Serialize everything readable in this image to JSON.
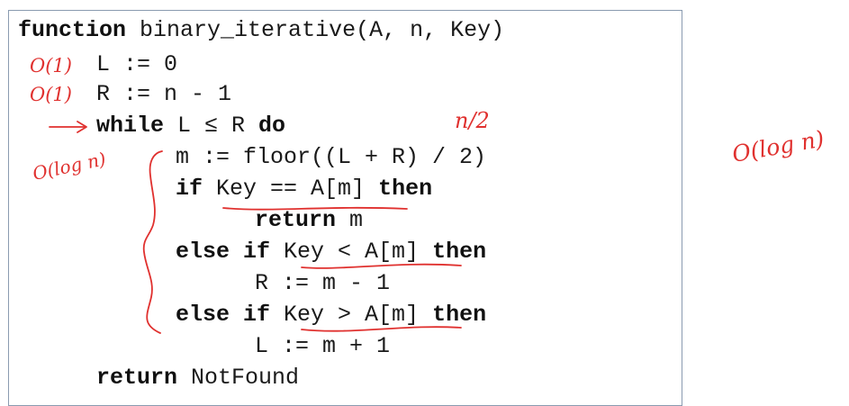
{
  "code": {
    "lines": [
      {
        "kw": "function",
        "text": " binary_iterative(A, n, Key)"
      },
      {
        "text": "L := 0"
      },
      {
        "text": "R := n - 1"
      },
      {
        "kw": "while",
        "text": " L ≤ R ",
        "kw2": "do"
      },
      {
        "text": "m := floor((L + R) / 2)"
      },
      {
        "kw": "if",
        "text": " Key == A[m] ",
        "kw2": "then"
      },
      {
        "kw": "return",
        "text": " m"
      },
      {
        "kw": "else if",
        "text": " Key < A[m] ",
        "kw2": "then"
      },
      {
        "text": "R := m - 1"
      },
      {
        "kw": "else if",
        "text": " Key > A[m] ",
        "kw2": "then"
      },
      {
        "text": "L := m + 1"
      },
      {
        "kw": "return",
        "text": " NotFound"
      }
    ]
  },
  "annotations": {
    "o1_first": "O(1)",
    "o1_second": "O(1)",
    "n_half": "n/2",
    "o_log_n_loop": "O(log n)",
    "o_log_n_total": "O(log n)"
  },
  "colors": {
    "ink": "#e0312f",
    "border": "#8a9bb0",
    "text": "#1a1a1a"
  }
}
